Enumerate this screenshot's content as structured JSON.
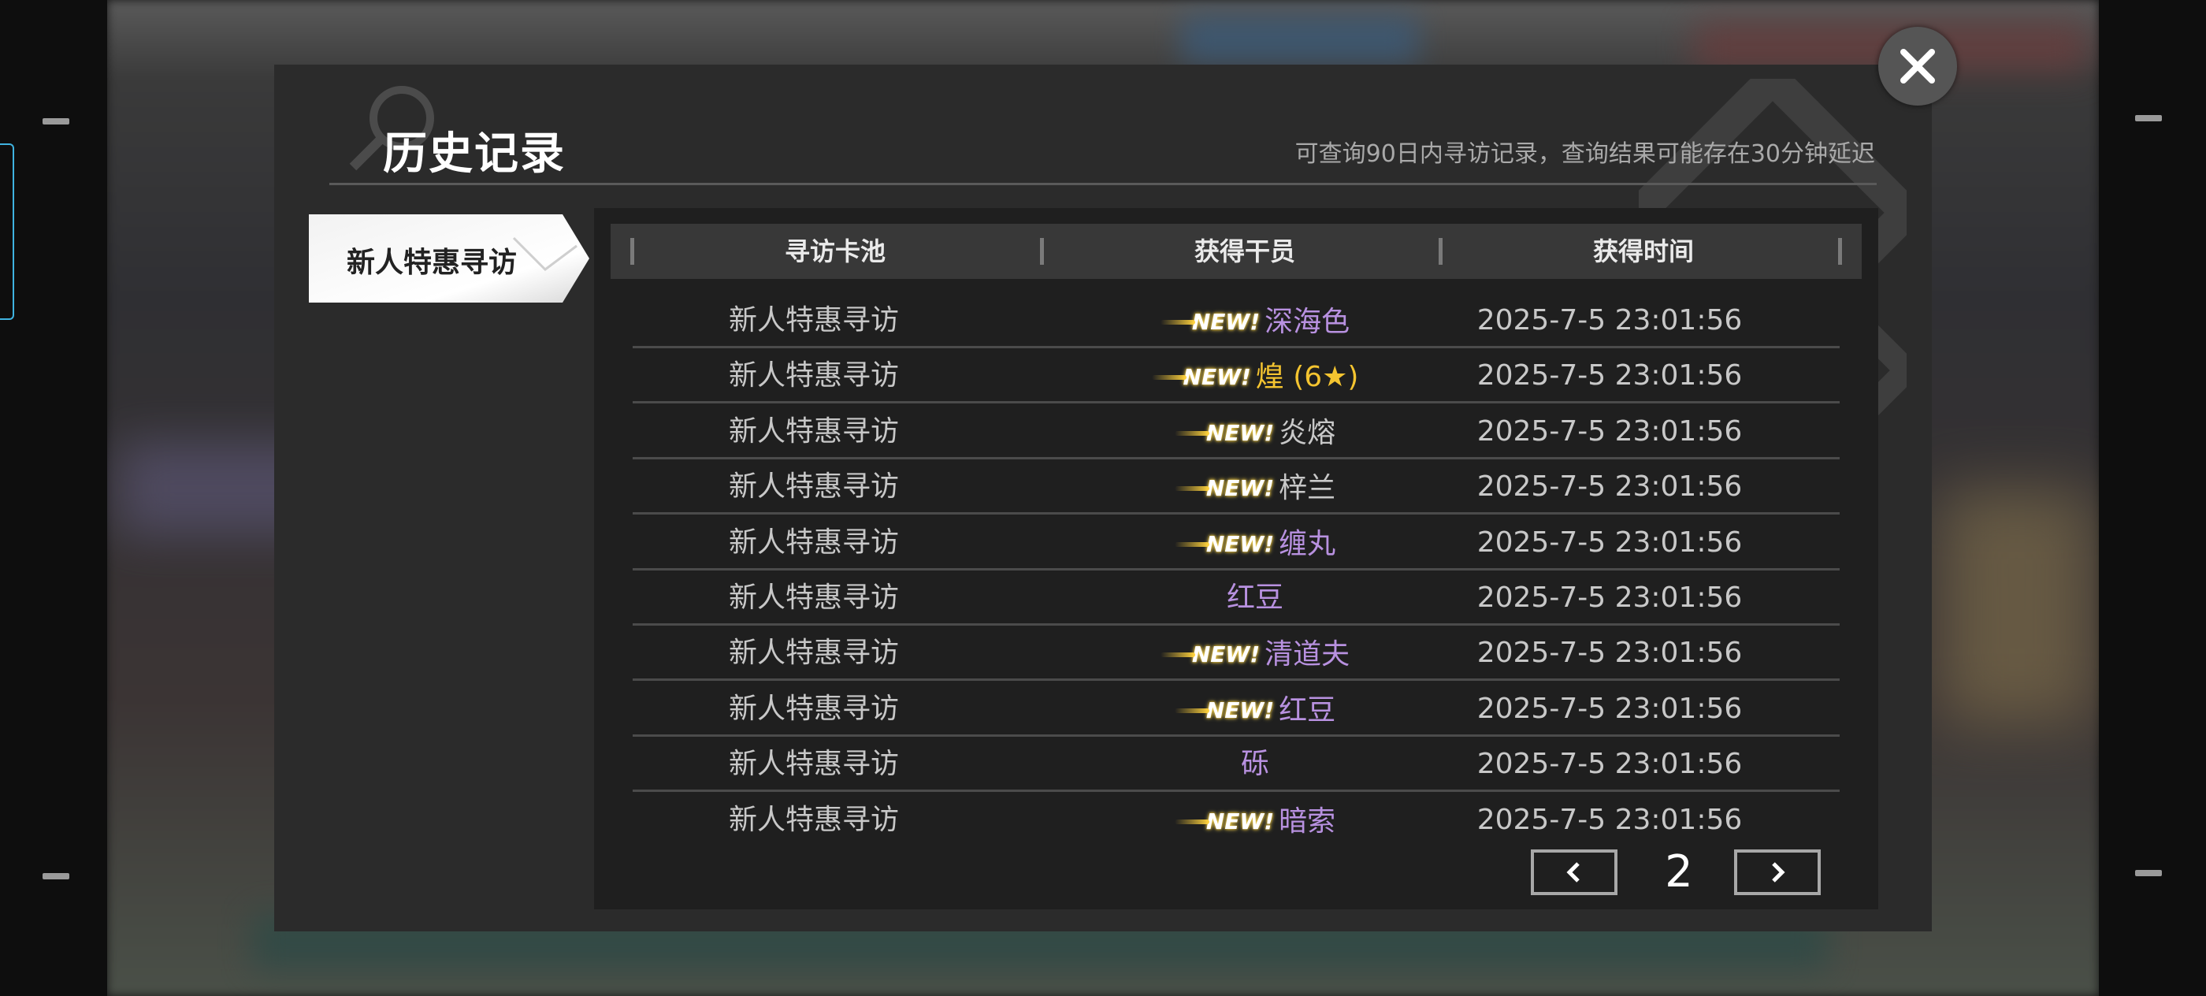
{
  "panel": {
    "title": "历史记录",
    "hint": "可查询90日内寻访记录，查询结果可能存在30分钟延迟"
  },
  "tabs": [
    {
      "label": "新人特惠寻访",
      "active": true
    }
  ],
  "table": {
    "headers": [
      "寻访卡池",
      "获得干员",
      "获得时间"
    ],
    "new_label": "NEW!",
    "rows": [
      {
        "pool": "新人特惠寻访",
        "operator": "深海色",
        "new": true,
        "color": "#b891e0",
        "time": "2025-7-5 23:01:56"
      },
      {
        "pool": "新人特惠寻访",
        "operator": "煌 (6★)",
        "new": true,
        "color": "#f4c430",
        "time": "2025-7-5 23:01:56"
      },
      {
        "pool": "新人特惠寻访",
        "operator": "炎熔",
        "new": true,
        "color": "#c8c8c8",
        "time": "2025-7-5 23:01:56"
      },
      {
        "pool": "新人特惠寻访",
        "operator": "梓兰",
        "new": true,
        "color": "#c8c8c8",
        "time": "2025-7-5 23:01:56"
      },
      {
        "pool": "新人特惠寻访",
        "operator": "缠丸",
        "new": true,
        "color": "#b891e0",
        "time": "2025-7-5 23:01:56"
      },
      {
        "pool": "新人特惠寻访",
        "operator": "红豆",
        "new": false,
        "color": "#b891e0",
        "time": "2025-7-5 23:01:56"
      },
      {
        "pool": "新人特惠寻访",
        "operator": "清道夫",
        "new": true,
        "color": "#b891e0",
        "time": "2025-7-5 23:01:56"
      },
      {
        "pool": "新人特惠寻访",
        "operator": "红豆",
        "new": true,
        "color": "#b891e0",
        "time": "2025-7-5 23:01:56"
      },
      {
        "pool": "新人特惠寻访",
        "operator": "砾",
        "new": false,
        "color": "#b891e0",
        "time": "2025-7-5 23:01:56"
      },
      {
        "pool": "新人特惠寻访",
        "operator": "暗索",
        "new": true,
        "color": "#b891e0",
        "time": "2025-7-5 23:01:56"
      }
    ]
  },
  "pager": {
    "current_page": "2",
    "prev_icon": "chevron-left-icon",
    "next_icon": "chevron-right-icon"
  },
  "close_icon": "close-icon"
}
